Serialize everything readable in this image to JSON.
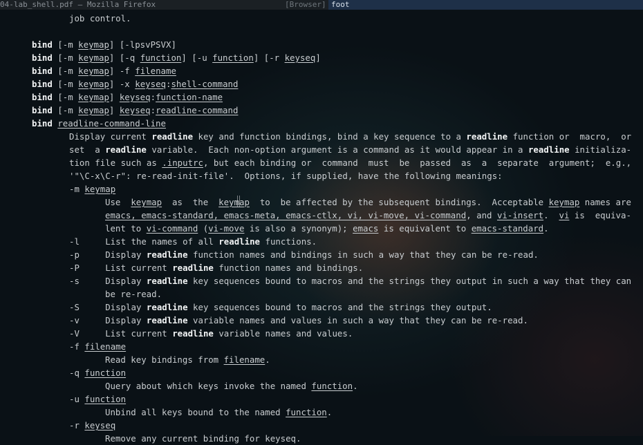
{
  "window": {
    "inactive_title": "04-lab_shell.pdf — Mozilla Firefox",
    "inactive_app": "[Browser]",
    "active_title": "foot"
  },
  "lines": [
    {
      "indent": 100,
      "segs": [
        {
          "t": "job control."
        }
      ]
    },
    {
      "indent": 0,
      "segs": []
    },
    {
      "indent": 46,
      "segs": [
        {
          "t": "bind",
          "s": "b"
        },
        {
          "t": " [-m "
        },
        {
          "t": "keymap",
          "s": "u"
        },
        {
          "t": "] [-lpsvPSVX]"
        }
      ]
    },
    {
      "indent": 46,
      "segs": [
        {
          "t": "bind",
          "s": "b"
        },
        {
          "t": " [-m "
        },
        {
          "t": "keymap",
          "s": "u"
        },
        {
          "t": "] [-q "
        },
        {
          "t": "function",
          "s": "u"
        },
        {
          "t": "] [-u "
        },
        {
          "t": "function",
          "s": "u"
        },
        {
          "t": "] [-r "
        },
        {
          "t": "keyseq",
          "s": "u"
        },
        {
          "t": "]"
        }
      ]
    },
    {
      "indent": 46,
      "segs": [
        {
          "t": "bind",
          "s": "b"
        },
        {
          "t": " [-m "
        },
        {
          "t": "keymap",
          "s": "u"
        },
        {
          "t": "] -f "
        },
        {
          "t": "filename",
          "s": "u"
        }
      ]
    },
    {
      "indent": 46,
      "segs": [
        {
          "t": "bind",
          "s": "b"
        },
        {
          "t": " [-m "
        },
        {
          "t": "keymap",
          "s": "u"
        },
        {
          "t": "] -x "
        },
        {
          "t": "keyseq",
          "s": "u"
        },
        {
          "t": ":"
        },
        {
          "t": "shell-command",
          "s": "u"
        }
      ]
    },
    {
      "indent": 46,
      "segs": [
        {
          "t": "bind",
          "s": "b"
        },
        {
          "t": " [-m "
        },
        {
          "t": "keymap",
          "s": "u"
        },
        {
          "t": "] "
        },
        {
          "t": "keyseq",
          "s": "u"
        },
        {
          "t": ":"
        },
        {
          "t": "function-name",
          "s": "u"
        }
      ]
    },
    {
      "indent": 46,
      "segs": [
        {
          "t": "bind",
          "s": "b"
        },
        {
          "t": " [-m "
        },
        {
          "t": "keymap",
          "s": "u"
        },
        {
          "t": "] "
        },
        {
          "t": "keyseq",
          "s": "u"
        },
        {
          "t": ":"
        },
        {
          "t": "readline-command",
          "s": "u"
        }
      ]
    },
    {
      "indent": 46,
      "segs": [
        {
          "t": "bind",
          "s": "b"
        },
        {
          "t": " "
        },
        {
          "t": "readline-command-line",
          "s": "u"
        }
      ]
    },
    {
      "indent": 100,
      "segs": [
        {
          "t": "Display current "
        },
        {
          "t": "readline",
          "s": "b"
        },
        {
          "t": " key and function bindings, bind a key sequence to a "
        },
        {
          "t": "readline",
          "s": "b"
        },
        {
          "t": " function or  macro,  or"
        }
      ]
    },
    {
      "indent": 100,
      "segs": [
        {
          "t": "set  a "
        },
        {
          "t": "readline",
          "s": "b"
        },
        {
          "t": " variable.  Each non-option argument is a command as it would appear in a "
        },
        {
          "t": "readline",
          "s": "b"
        },
        {
          "t": " initializa-"
        }
      ]
    },
    {
      "indent": 100,
      "segs": [
        {
          "t": "tion file such as "
        },
        {
          "t": ".inputrc",
          "s": "u"
        },
        {
          "t": ", but each binding or  command  must  be  passed  as  a  separate  argument;  e.g.,"
        }
      ]
    },
    {
      "indent": 100,
      "segs": [
        {
          "t": "'\"\\C-x\\C-r\": re-read-init-file'.  Options, if supplied, have the following meanings:"
        }
      ]
    },
    {
      "indent": 100,
      "segs": [
        {
          "t": "-m "
        },
        {
          "t": "keymap",
          "s": "u"
        }
      ]
    },
    {
      "indent": 152,
      "segs": [
        {
          "t": "Use  "
        },
        {
          "t": "keymap",
          "s": "u"
        },
        {
          "t": "  as  the  "
        },
        {
          "t": "keymap",
          "s": "u"
        },
        {
          "t": "  to  be affected by the subsequent bindings.  Acceptable "
        },
        {
          "t": "keymap",
          "s": "u"
        },
        {
          "t": " names are"
        }
      ]
    },
    {
      "indent": 152,
      "segs": [
        {
          "t": "emacs, emacs-standard, emacs-meta, emacs-ctlx, vi, vi-move, vi-command",
          "s": "u"
        },
        {
          "t": ", and "
        },
        {
          "t": "vi-insert",
          "s": "u"
        },
        {
          "t": ".  "
        },
        {
          "t": "vi",
          "s": "u"
        },
        {
          "t": " is  equiva-"
        }
      ]
    },
    {
      "indent": 152,
      "segs": [
        {
          "t": "lent to "
        },
        {
          "t": "vi-command",
          "s": "u"
        },
        {
          "t": " ("
        },
        {
          "t": "vi-move",
          "s": "u"
        },
        {
          "t": " is also a synonym); "
        },
        {
          "t": "emacs",
          "s": "u"
        },
        {
          "t": " is equivalent to "
        },
        {
          "t": "emacs-standard",
          "s": "u"
        },
        {
          "t": "."
        }
      ]
    },
    {
      "indent": 100,
      "segs": [
        {
          "t": "-l     List the names of all "
        },
        {
          "t": "readline",
          "s": "b"
        },
        {
          "t": " functions."
        }
      ]
    },
    {
      "indent": 100,
      "segs": [
        {
          "t": "-p     Display "
        },
        {
          "t": "readline",
          "s": "b"
        },
        {
          "t": " function names and bindings in such a way that they can be re-read."
        }
      ]
    },
    {
      "indent": 100,
      "segs": [
        {
          "t": "-P     List current "
        },
        {
          "t": "readline",
          "s": "b"
        },
        {
          "t": " function names and bindings."
        }
      ]
    },
    {
      "indent": 100,
      "segs": [
        {
          "t": "-s     Display "
        },
        {
          "t": "readline",
          "s": "b"
        },
        {
          "t": " key sequences bound to macros and the strings they output in such a way that they can"
        }
      ]
    },
    {
      "indent": 152,
      "segs": [
        {
          "t": "be re-read."
        }
      ]
    },
    {
      "indent": 100,
      "segs": [
        {
          "t": "-S     Display "
        },
        {
          "t": "readline",
          "s": "b"
        },
        {
          "t": " key sequences bound to macros and the strings they output."
        }
      ]
    },
    {
      "indent": 100,
      "segs": [
        {
          "t": "-v     Display "
        },
        {
          "t": "readline",
          "s": "b"
        },
        {
          "t": " variable names and values in such a way that they can be re-read."
        }
      ]
    },
    {
      "indent": 100,
      "segs": [
        {
          "t": "-V     List current "
        },
        {
          "t": "readline",
          "s": "b"
        },
        {
          "t": " variable names and values."
        }
      ]
    },
    {
      "indent": 100,
      "segs": [
        {
          "t": "-f "
        },
        {
          "t": "filename",
          "s": "u"
        }
      ]
    },
    {
      "indent": 152,
      "segs": [
        {
          "t": "Read key bindings from "
        },
        {
          "t": "filename",
          "s": "u"
        },
        {
          "t": "."
        }
      ]
    },
    {
      "indent": 100,
      "segs": [
        {
          "t": "-q "
        },
        {
          "t": "function",
          "s": "u"
        }
      ]
    },
    {
      "indent": 152,
      "segs": [
        {
          "t": "Query about which keys invoke the named "
        },
        {
          "t": "function",
          "s": "u"
        },
        {
          "t": "."
        }
      ]
    },
    {
      "indent": 100,
      "segs": [
        {
          "t": "-u "
        },
        {
          "t": "function",
          "s": "u"
        }
      ]
    },
    {
      "indent": 152,
      "segs": [
        {
          "t": "Unbind all keys bound to the named "
        },
        {
          "t": "function",
          "s": "u"
        },
        {
          "t": "."
        }
      ]
    },
    {
      "indent": 100,
      "segs": [
        {
          "t": "-r "
        },
        {
          "t": "keyseq",
          "s": "u"
        }
      ]
    },
    {
      "indent": 152,
      "segs": [
        {
          "t": "Remove any current binding for keyseq."
        }
      ]
    }
  ]
}
